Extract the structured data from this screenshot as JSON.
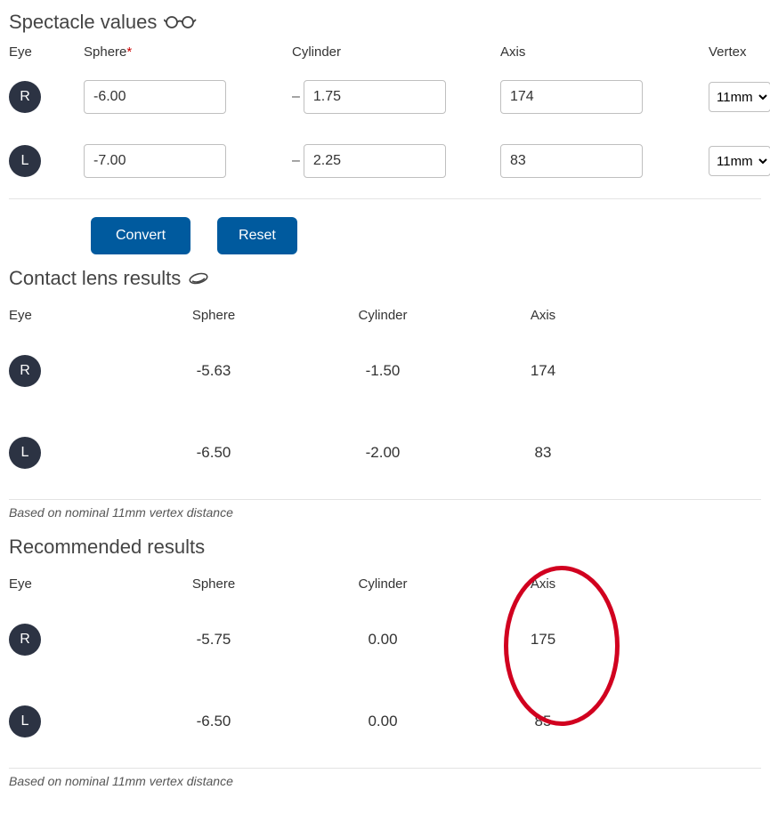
{
  "spectacle": {
    "title": "Spectacle values",
    "headers": {
      "eye": "Eye",
      "sphere": "Sphere",
      "sphere_req": "*",
      "cylinder": "Cylinder",
      "axis": "Axis",
      "vertex": "Vertex"
    },
    "rows": [
      {
        "eye": "R",
        "sphere": "-6.00",
        "cylinder": "1.75",
        "axis": "174",
        "vertex": "11mm"
      },
      {
        "eye": "L",
        "sphere": "-7.00",
        "cylinder": "2.25",
        "axis": "83",
        "vertex": "11mm"
      }
    ],
    "convert_label": "Convert",
    "reset_label": "Reset"
  },
  "contact": {
    "title": "Contact lens results",
    "headers": {
      "eye": "Eye",
      "sphere": "Sphere",
      "cylinder": "Cylinder",
      "axis": "Axis"
    },
    "rows": [
      {
        "eye": "R",
        "sphere": "-5.63",
        "cylinder": "-1.50",
        "axis": "174"
      },
      {
        "eye": "L",
        "sphere": "-6.50",
        "cylinder": "-2.00",
        "axis": "83"
      }
    ],
    "note": "Based on nominal 11mm vertex distance"
  },
  "recommended": {
    "title": "Recommended results",
    "headers": {
      "eye": "Eye",
      "sphere": "Sphere",
      "cylinder": "Cylinder",
      "axis": "Axis"
    },
    "rows": [
      {
        "eye": "R",
        "sphere": "-5.75",
        "cylinder": "0.00",
        "axis": "175"
      },
      {
        "eye": "L",
        "sphere": "-6.50",
        "cylinder": "0.00",
        "axis": "85"
      }
    ],
    "note": "Based on nominal 11mm vertex distance"
  }
}
